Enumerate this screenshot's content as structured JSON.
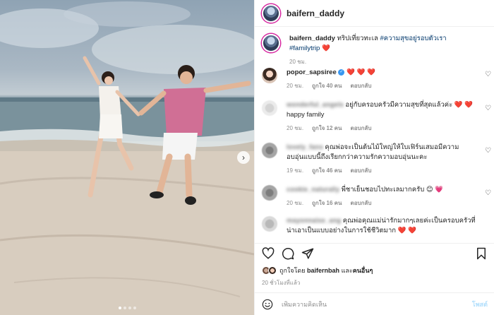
{
  "post": {
    "username": "baifern_daddy",
    "caption_text": "ทริปเที่ยวทะเล",
    "hashtag_1": "#ความสุขอยู่รอบตัวเรา",
    "hashtag_2": "#familytrip",
    "caption_emoji": "❤️",
    "caption_time": "20 ชม."
  },
  "comments": [
    {
      "user": "popor_sapsiree",
      "text": "❤️ ❤️ ❤️",
      "time": "20 ชม.",
      "likes": "ถูกใจ 40 คน",
      "reply": "ตอบกลับ"
    },
    {
      "user": "wonderful_angels",
      "text": "อยู่กับครอบครัวมีความสุขที่สุดแล้วค่ะ ❤️ ❤️ happy family",
      "time": "20 ชม.",
      "likes": "ถูกใจ 12 คน",
      "reply": "ตอบกลับ"
    },
    {
      "user": "lovely_fans",
      "text": "คุณพ่อจะเป็นต้นไม้ใหญ่ให้ใบเฟิร์นเสมอมีความอบอุ่นแบบนี้ถึงเรียกกว่าความรักความอบอุ่นนะคะ",
      "time": "19 ชม.",
      "likes": "ถูกใจ 46 คน",
      "reply": "ตอบกลับ"
    },
    {
      "user": "cookie_naturally",
      "text": "พี่ชาเย็นชอบไปทะเลมากครับ 😊 💗",
      "time": "20 ชม.",
      "likes": "ถูกใจ 16 คน",
      "reply": "ตอบกลับ"
    },
    {
      "user": "mayonnaise_ang",
      "text": "คุณพ่อคุณแม่น่ารักมากๆเลยค่ะเป็นครอบครัวที่น่าเอาเป็นแบบอย่างในการใช้ชีวิตมาก ❤️ ❤️",
      "time": "",
      "likes": "",
      "reply": ""
    }
  ],
  "likes_line": {
    "prefix": "ถูกใจโดย",
    "user": "baifernbah",
    "joiner": "และ",
    "others": "คนอื่นๆ"
  },
  "timeago": "20 ชั่วโมงที่แล้ว",
  "composer": {
    "placeholder": "เพิ่มความคิดเห็น",
    "post_label": "โพสต์"
  },
  "icons": {
    "next": "chevron-right-icon",
    "like": "heart-icon",
    "comment": "comment-icon",
    "share": "send-icon",
    "save": "bookmark-icon",
    "emoji": "emoji-icon"
  },
  "colors": {
    "hashtag": "#00376b",
    "heart": "#e0245e",
    "verified": "#3897f0",
    "post_disabled": "#b2dffc"
  },
  "carousel": {
    "slides": 4,
    "active_index": 0
  }
}
